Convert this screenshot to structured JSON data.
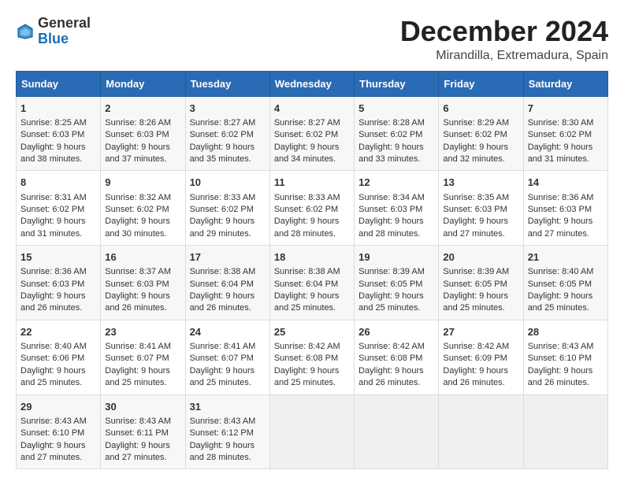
{
  "logo": {
    "text_general": "General",
    "text_blue": "Blue"
  },
  "header": {
    "month": "December 2024",
    "location": "Mirandilla, Extremadura, Spain"
  },
  "weekdays": [
    "Sunday",
    "Monday",
    "Tuesday",
    "Wednesday",
    "Thursday",
    "Friday",
    "Saturday"
  ],
  "weeks": [
    [
      {
        "day": "1",
        "sunrise": "8:25 AM",
        "sunset": "6:03 PM",
        "daylight": "9 hours and 38 minutes."
      },
      {
        "day": "2",
        "sunrise": "8:26 AM",
        "sunset": "6:03 PM",
        "daylight": "9 hours and 37 minutes."
      },
      {
        "day": "3",
        "sunrise": "8:27 AM",
        "sunset": "6:02 PM",
        "daylight": "9 hours and 35 minutes."
      },
      {
        "day": "4",
        "sunrise": "8:27 AM",
        "sunset": "6:02 PM",
        "daylight": "9 hours and 34 minutes."
      },
      {
        "day": "5",
        "sunrise": "8:28 AM",
        "sunset": "6:02 PM",
        "daylight": "9 hours and 33 minutes."
      },
      {
        "day": "6",
        "sunrise": "8:29 AM",
        "sunset": "6:02 PM",
        "daylight": "9 hours and 32 minutes."
      },
      {
        "day": "7",
        "sunrise": "8:30 AM",
        "sunset": "6:02 PM",
        "daylight": "9 hours and 31 minutes."
      }
    ],
    [
      {
        "day": "8",
        "sunrise": "8:31 AM",
        "sunset": "6:02 PM",
        "daylight": "9 hours and 31 minutes."
      },
      {
        "day": "9",
        "sunrise": "8:32 AM",
        "sunset": "6:02 PM",
        "daylight": "9 hours and 30 minutes."
      },
      {
        "day": "10",
        "sunrise": "8:33 AM",
        "sunset": "6:02 PM",
        "daylight": "9 hours and 29 minutes."
      },
      {
        "day": "11",
        "sunrise": "8:33 AM",
        "sunset": "6:02 PM",
        "daylight": "9 hours and 28 minutes."
      },
      {
        "day": "12",
        "sunrise": "8:34 AM",
        "sunset": "6:03 PM",
        "daylight": "9 hours and 28 minutes."
      },
      {
        "day": "13",
        "sunrise": "8:35 AM",
        "sunset": "6:03 PM",
        "daylight": "9 hours and 27 minutes."
      },
      {
        "day": "14",
        "sunrise": "8:36 AM",
        "sunset": "6:03 PM",
        "daylight": "9 hours and 27 minutes."
      }
    ],
    [
      {
        "day": "15",
        "sunrise": "8:36 AM",
        "sunset": "6:03 PM",
        "daylight": "9 hours and 26 minutes."
      },
      {
        "day": "16",
        "sunrise": "8:37 AM",
        "sunset": "6:03 PM",
        "daylight": "9 hours and 26 minutes."
      },
      {
        "day": "17",
        "sunrise": "8:38 AM",
        "sunset": "6:04 PM",
        "daylight": "9 hours and 26 minutes."
      },
      {
        "day": "18",
        "sunrise": "8:38 AM",
        "sunset": "6:04 PM",
        "daylight": "9 hours and 25 minutes."
      },
      {
        "day": "19",
        "sunrise": "8:39 AM",
        "sunset": "6:05 PM",
        "daylight": "9 hours and 25 minutes."
      },
      {
        "day": "20",
        "sunrise": "8:39 AM",
        "sunset": "6:05 PM",
        "daylight": "9 hours and 25 minutes."
      },
      {
        "day": "21",
        "sunrise": "8:40 AM",
        "sunset": "6:05 PM",
        "daylight": "9 hours and 25 minutes."
      }
    ],
    [
      {
        "day": "22",
        "sunrise": "8:40 AM",
        "sunset": "6:06 PM",
        "daylight": "9 hours and 25 minutes."
      },
      {
        "day": "23",
        "sunrise": "8:41 AM",
        "sunset": "6:07 PM",
        "daylight": "9 hours and 25 minutes."
      },
      {
        "day": "24",
        "sunrise": "8:41 AM",
        "sunset": "6:07 PM",
        "daylight": "9 hours and 25 minutes."
      },
      {
        "day": "25",
        "sunrise": "8:42 AM",
        "sunset": "6:08 PM",
        "daylight": "9 hours and 25 minutes."
      },
      {
        "day": "26",
        "sunrise": "8:42 AM",
        "sunset": "6:08 PM",
        "daylight": "9 hours and 26 minutes."
      },
      {
        "day": "27",
        "sunrise": "8:42 AM",
        "sunset": "6:09 PM",
        "daylight": "9 hours and 26 minutes."
      },
      {
        "day": "28",
        "sunrise": "8:43 AM",
        "sunset": "6:10 PM",
        "daylight": "9 hours and 26 minutes."
      }
    ],
    [
      {
        "day": "29",
        "sunrise": "8:43 AM",
        "sunset": "6:10 PM",
        "daylight": "9 hours and 27 minutes."
      },
      {
        "day": "30",
        "sunrise": "8:43 AM",
        "sunset": "6:11 PM",
        "daylight": "9 hours and 27 minutes."
      },
      {
        "day": "31",
        "sunrise": "8:43 AM",
        "sunset": "6:12 PM",
        "daylight": "9 hours and 28 minutes."
      },
      null,
      null,
      null,
      null
    ]
  ],
  "labels": {
    "sunrise": "Sunrise: ",
    "sunset": "Sunset: ",
    "daylight": "Daylight: "
  }
}
